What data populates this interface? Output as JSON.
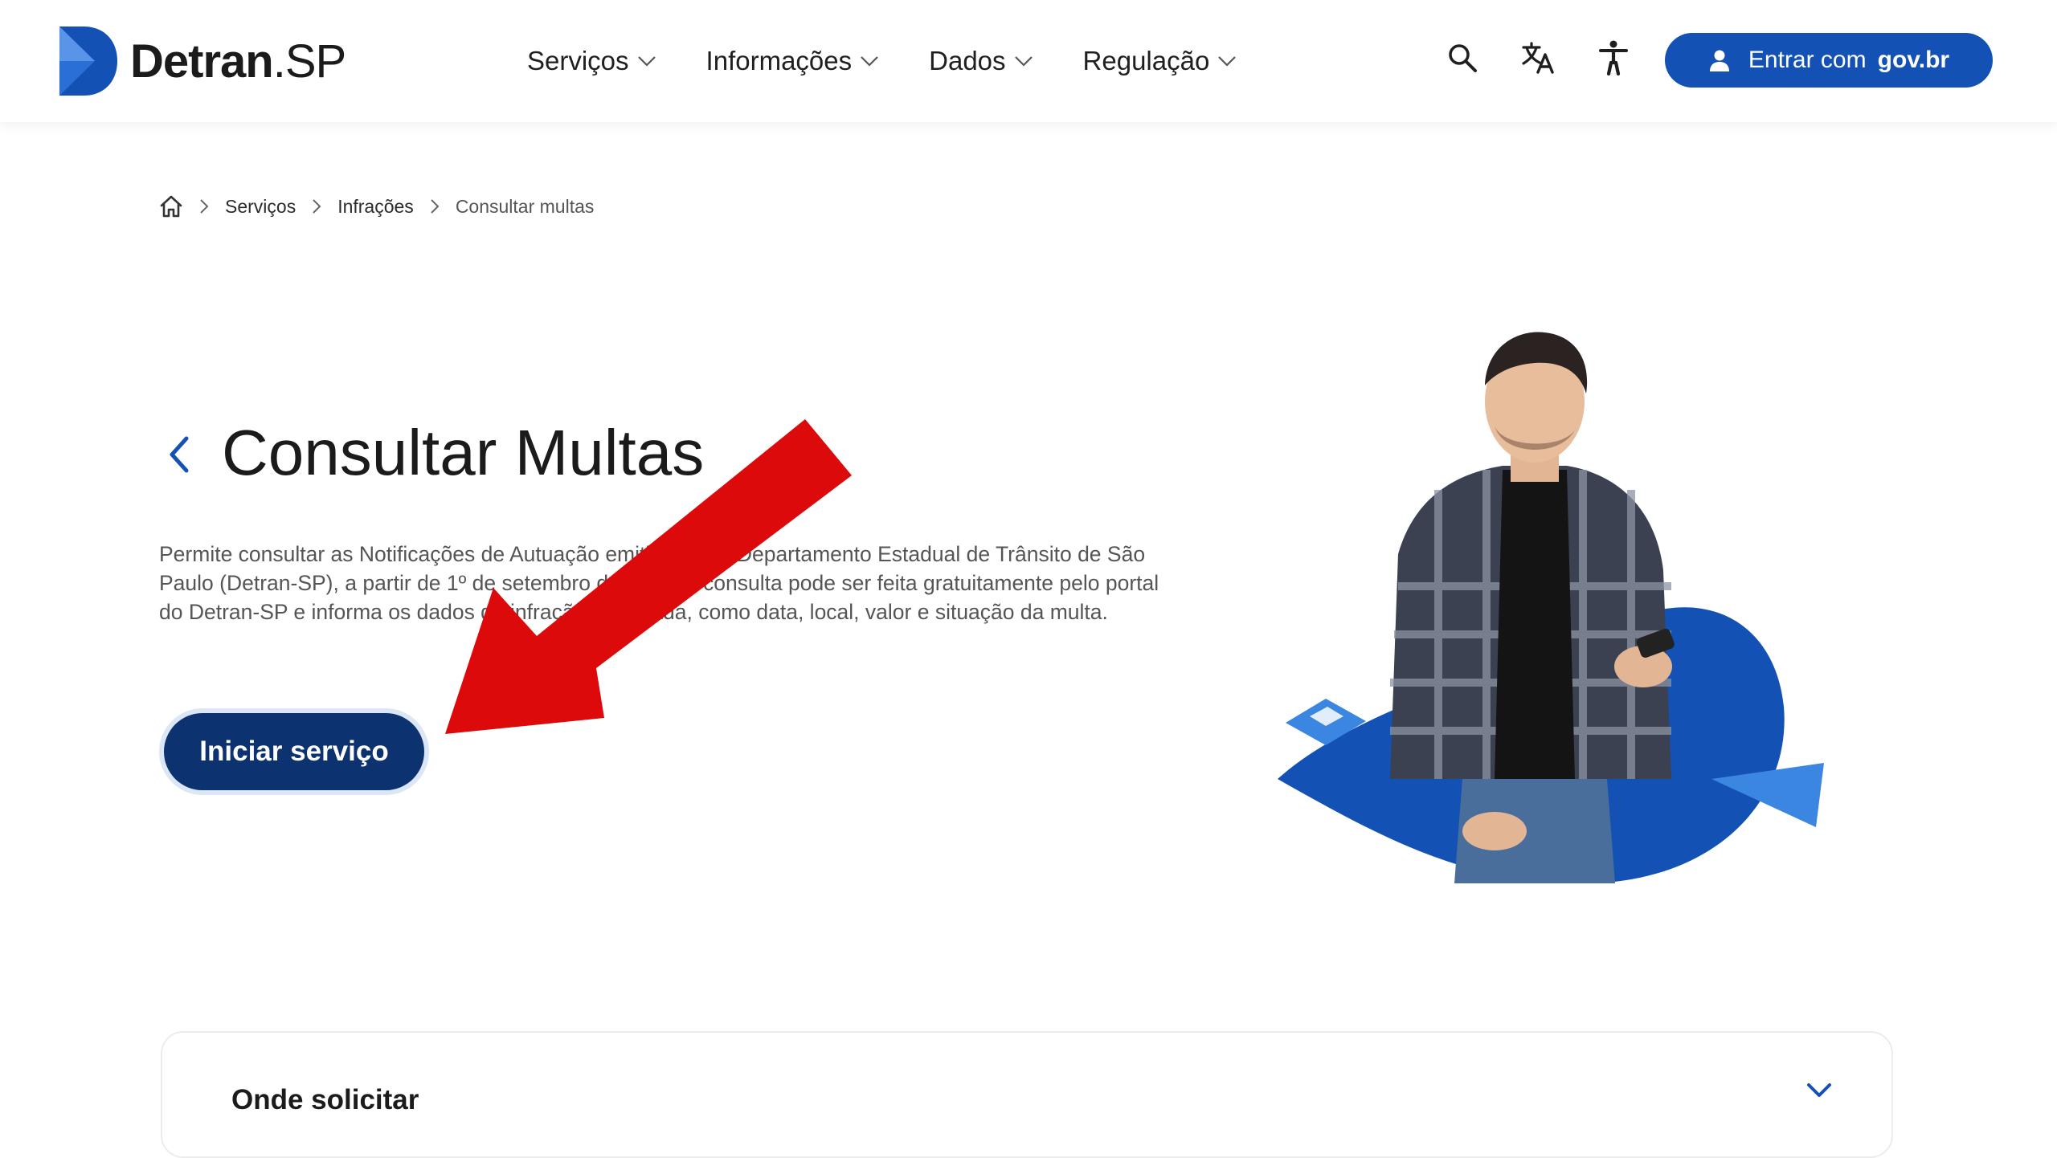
{
  "header": {
    "logo": {
      "word": "Detran",
      "suffix": ".SP",
      "brand_color": "#1351b4"
    },
    "nav": [
      {
        "label": "Serviços"
      },
      {
        "label": "Informações"
      },
      {
        "label": "Dados"
      },
      {
        "label": "Regulação"
      }
    ],
    "icons": [
      "search-icon",
      "translate-icon",
      "accessibility-icon"
    ],
    "login": {
      "prefix": "Entrar com",
      "brand": "gov.br",
      "color": "#1351b4"
    }
  },
  "breadcrumb": {
    "home_icon": "home-icon",
    "items": [
      "Serviços",
      "Infrações"
    ],
    "current": "Consultar multas"
  },
  "main": {
    "title": "Consultar Multas",
    "description": "Permite consultar as Notificações de Autuação emitidas pelo Departamento Estadual de Trânsito de São Paulo (Detran-SP), a partir de 1º de setembro de 2018. A consulta pode ser feita gratuitamente pelo portal do Detran-SP e informa os dados da infração registrada, como data, local, valor e situação da multa.",
    "start_button": "Iniciar serviço",
    "start_button_color": "#0c326f",
    "annotation": "red-arrow-icon"
  },
  "accordion": {
    "title": "Onde solicitar"
  }
}
